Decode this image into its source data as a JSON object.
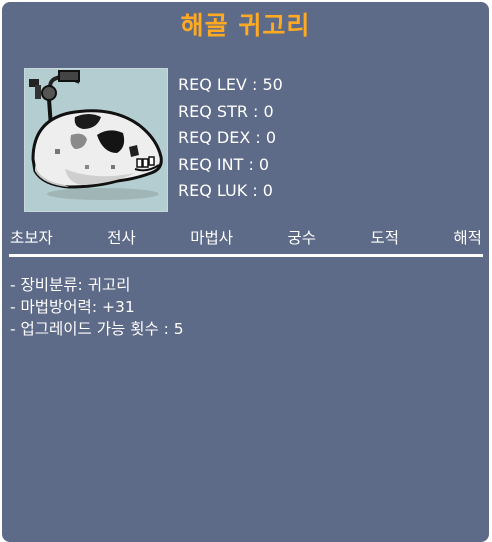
{
  "item": {
    "name": "해골 귀고리",
    "icon": "skull-earring-icon",
    "name_color": "#ffaa22",
    "panel_color": "#5d6a88"
  },
  "requirements": [
    "REQ LEV : 50",
    "REQ STR : 0",
    "REQ DEX : 0",
    "REQ INT : 0",
    "REQ LUK : 0"
  ],
  "jobs": [
    "초보자",
    "전사",
    "마법사",
    "궁수",
    "도적",
    "해적"
  ],
  "description": [
    "- 장비분류: 귀고리",
    "- 마법방어력: +31",
    "- 업그레이드 가능 횟수 : 5"
  ]
}
